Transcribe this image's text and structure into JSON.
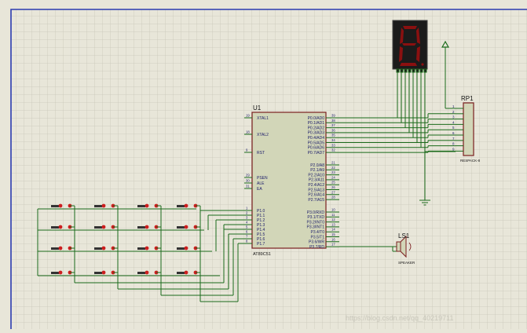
{
  "palette": {
    "background": "#e8e6d9",
    "grid": "#c9c7b9",
    "border": "#2b3bb0",
    "wire": "#1a6a1a",
    "component_outline": "#7a1f1f",
    "component_fill": "#d2d6b8",
    "pin_text": "#1a1a6a",
    "button_dot": "#cc1e1e",
    "display_body": "#1b1b1b",
    "display_segment": "#8a1010"
  },
  "u1": {
    "ref": "U1",
    "part": "AT89C51",
    "left_pins": [
      {
        "num": "19",
        "name": "XTAL1"
      },
      {
        "num": "18",
        "name": "XTAL2"
      },
      {
        "num": "9",
        "name": "RST"
      },
      {
        "num": "29",
        "name": "PSEN"
      },
      {
        "num": "30",
        "name": "ALE"
      },
      {
        "num": "31",
        "name": "EA"
      },
      {
        "num": "1",
        "name": "P1.0"
      },
      {
        "num": "2",
        "name": "P1.1"
      },
      {
        "num": "3",
        "name": "P1.2"
      },
      {
        "num": "4",
        "name": "P1.3"
      },
      {
        "num": "5",
        "name": "P1.4"
      },
      {
        "num": "6",
        "name": "P1.5"
      },
      {
        "num": "7",
        "name": "P1.6"
      },
      {
        "num": "8",
        "name": "P1.7"
      }
    ],
    "right_pins_p0": [
      {
        "num": "39",
        "name": "P0.0/AD0"
      },
      {
        "num": "38",
        "name": "P0.1/AD1"
      },
      {
        "num": "37",
        "name": "P0.2/AD2"
      },
      {
        "num": "36",
        "name": "P0.3/AD3"
      },
      {
        "num": "35",
        "name": "P0.4/AD4"
      },
      {
        "num": "34",
        "name": "P0.5/AD5"
      },
      {
        "num": "33",
        "name": "P0.6/AD6"
      },
      {
        "num": "32",
        "name": "P0.7/AD7"
      }
    ],
    "right_pins_p2": [
      {
        "num": "21",
        "name": "P2.0/A8"
      },
      {
        "num": "22",
        "name": "P2.1/A9"
      },
      {
        "num": "23",
        "name": "P2.2/A10"
      },
      {
        "num": "24",
        "name": "P2.3/A11"
      },
      {
        "num": "25",
        "name": "P2.4/A12"
      },
      {
        "num": "26",
        "name": "P2.5/A13"
      },
      {
        "num": "27",
        "name": "P2.6/A14"
      },
      {
        "num": "28",
        "name": "P2.7/A15"
      }
    ],
    "right_pins_p3": [
      {
        "num": "10",
        "name": "P3.0/RXD"
      },
      {
        "num": "11",
        "name": "P3.1/TXD"
      },
      {
        "num": "12",
        "name": "P3.2/INT0"
      },
      {
        "num": "13",
        "name": "P3.3/INT1"
      },
      {
        "num": "14",
        "name": "P3.4/T0"
      },
      {
        "num": "15",
        "name": "P3.5/T1"
      },
      {
        "num": "16",
        "name": "P3.6/WR"
      },
      {
        "num": "17",
        "name": "P3.7/RD"
      }
    ]
  },
  "rp1": {
    "ref": "RP1",
    "part": "RESPACK-8",
    "pins": [
      "1",
      "2",
      "3",
      "4",
      "5",
      "6",
      "7",
      "8",
      "9"
    ]
  },
  "ls1": {
    "ref": "LS1",
    "part": "SPEAKER"
  },
  "display": {
    "digit": "8"
  },
  "keypad": {
    "rows": 4,
    "cols": 4
  },
  "watermark": "https://blog.csdn.net/qq_40219711"
}
